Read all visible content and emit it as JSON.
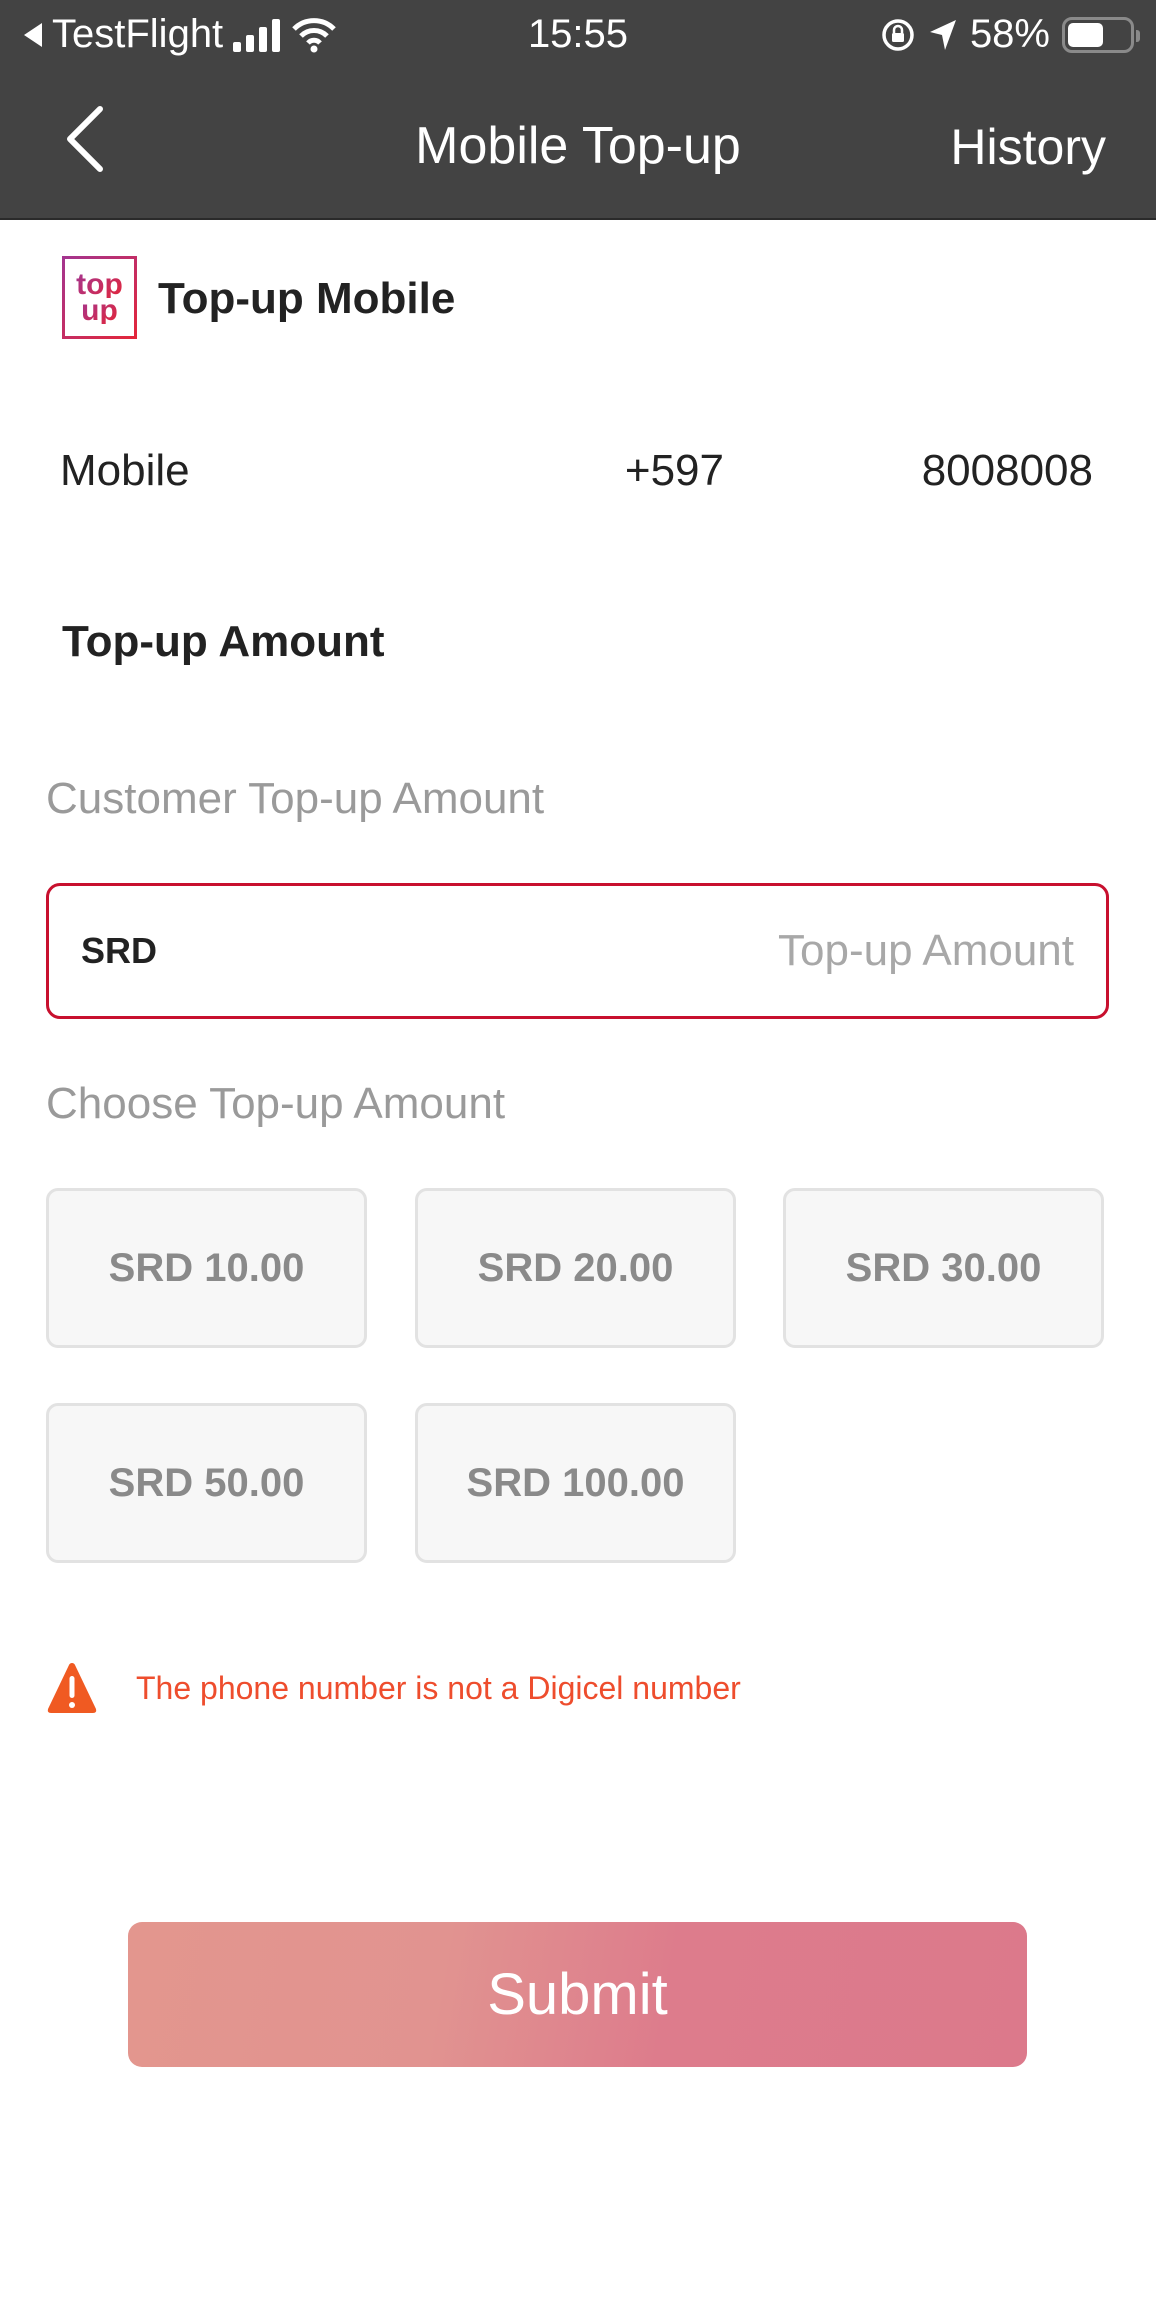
{
  "status_bar": {
    "back_app": "TestFlight",
    "time": "15:55",
    "battery_percent": "58%",
    "battery_level": 0.58,
    "icons": [
      "back-triangle-icon",
      "signal-icon",
      "wifi-icon",
      "rotation-lock-icon",
      "location-arrow-icon",
      "battery-icon"
    ]
  },
  "nav": {
    "title": "Mobile Top-up",
    "back_icon": "chevron-left-icon",
    "history_label": "History"
  },
  "brand": {
    "logo_line1": "top",
    "logo_line2": "up",
    "title": "Top-up Mobile"
  },
  "mobile": {
    "label": "Mobile",
    "country_code": "+597",
    "number": "8008008"
  },
  "amount_section": {
    "heading": "Top-up Amount",
    "customer_label": "Customer Top-up Amount",
    "currency": "SRD",
    "input_value": "",
    "input_placeholder": "Top-up Amount",
    "choose_label": "Choose Top-up Amount",
    "options": [
      {
        "label": "SRD 10.00"
      },
      {
        "label": "SRD 20.00"
      },
      {
        "label": "SRD 30.00"
      },
      {
        "label": "SRD 50.00"
      },
      {
        "label": "SRD 100.00"
      }
    ]
  },
  "warning": {
    "icon": "warning-triangle-icon",
    "message": "The phone number is not a Digicel number",
    "color": "#ee4d2d"
  },
  "submit": {
    "label": "Submit"
  },
  "colors": {
    "header_bg": "#434343",
    "input_border": "#c8102e",
    "submit_start": "#e3968e",
    "submit_end": "#dc798b"
  }
}
